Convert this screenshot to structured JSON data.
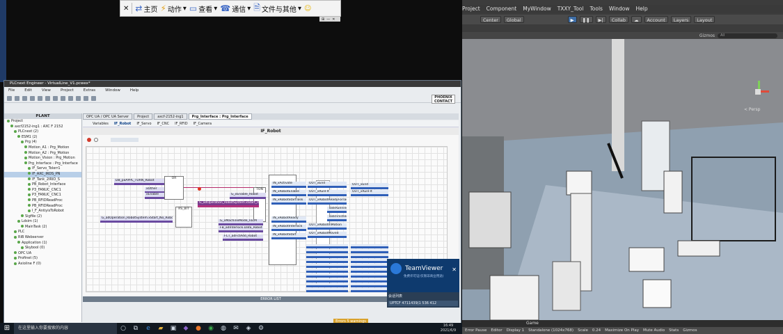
{
  "remote_toolbar": {
    "home": "主页",
    "actions": "动作",
    "view": "查看",
    "comm": "通信",
    "files": "文件与其他"
  },
  "plcnext": {
    "title": "PLCnext Engineer - VirtualLine_V1.pcwex*",
    "menu": [
      "File",
      "Edit",
      "View",
      "Project",
      "Extras",
      "Window",
      "Help"
    ],
    "logo": "PHOENIX CONTACT",
    "plant_header": "PLANT",
    "plant_items": [
      "Project",
      "axcf2152-ing1 : AXC F 2152",
      "PLCnext (2)",
      "ESM1 (2)",
      "Prg (4)",
      "Motion_A1 : Prg_Motion",
      "Motion_A2 : Prg_Motion",
      "Motion_Vision : Prg_Motion",
      "Prg_Interface : Prg_Interface",
      "IF_Servo_Tolerr1",
      "IF_AXC_IRDS_PN",
      "IF_Tank_2IRIO_S",
      "PB_Robot_Interface",
      "P3_FANUC_CNC1",
      "P3_FANUC_CNC1",
      "PB_RFIDReadProc",
      "PB_RFIDReadProc",
      "I_F_AntiyisToRobot",
      "Sigfile (2)",
      "Ldsim (1)",
      "MainTask (2)",
      "PLC",
      "RiB Webserver",
      "Application (1)",
      "Skybool (0)",
      "OPC UA",
      "Profinet (5)",
      "Axioline F (0)"
    ],
    "tabs": [
      "OPC UA / OPC UA Server",
      "Project",
      "axcf-2152-ing1",
      "Prg_Interface : Prg_Interface"
    ],
    "subtabs": [
      "Variables",
      "IF_Robot",
      "IF_Servo",
      "IF_CNC",
      "IF_RFID",
      "IF_Camera"
    ],
    "editor_title": "IF_Robot",
    "blocks": [
      "OR",
      "RS_BIT",
      "TON"
    ],
    "vars_left": [
      "DB_paAPPL_TURN_Robot",
      "xOther",
      "xEnable",
      "G_adOperation_RobotSystem.xStart_No_Robot"
    ],
    "vars_mid": [
      "G_xEnable_Robot",
      "G_adOperation_RobotSystem.xStart_Robot",
      "G_xMachineMode_FacM",
      "FB_adInterlock.Data_Robot",
      "FCT_adFctAdd_Robot"
    ],
    "vars_right": [
      "IN_xActivate",
      "IN_xRobotEnable",
      "IN_xRobotStartTask",
      "IN_xRobotReady",
      "IN_xRobotInterlock",
      "IN_xRobotStart"
    ],
    "vars_out": [
      "OUT_xEnd",
      "OUT_xRunFlt",
      "OUT_xRobotReadyForTask",
      "TaskRunning",
      "TaskFinished",
      "OUT_xRobotInMotion",
      "OUT_xRobotMoved"
    ],
    "error_list": "ERROR LIST",
    "error_count": "Errors 5 warnings",
    "taskbar_search": "在这里输入你要搜索的内容",
    "clock": [
      "16:49",
      "2021/6/9"
    ]
  },
  "teamviewer": {
    "title": "TeamViewer",
    "sub": "免费许可证(仅限非商业用途)",
    "session": "会话列表",
    "session_id": "UPTCF 4711439(1 536 412"
  },
  "unity": {
    "menu": [
      "Project",
      "Component",
      "MyWindow",
      "TXXY_Tool",
      "Tools",
      "Window",
      "Help"
    ],
    "center": "Center",
    "global": "Global",
    "collab": "Collab",
    "account": "Account",
    "layers": "Layers",
    "layout": "Layout",
    "gizmos": "Gizmos",
    "search": "All",
    "persp": "< Persp",
    "game_tab": "Game",
    "status": [
      "Error Pause",
      "Editor",
      "Display 1",
      "Standalone (1024x768)",
      "Scale",
      "0.24",
      "Maximize On Play",
      "Mute Audio",
      "Stats",
      "Gizmos"
    ]
  },
  "colors": {
    "plc_header": "#3a3a3a",
    "teamviewer": "#0e3a6e",
    "unity_bg": "#3c3c3c",
    "wire": "#b52b6b"
  }
}
